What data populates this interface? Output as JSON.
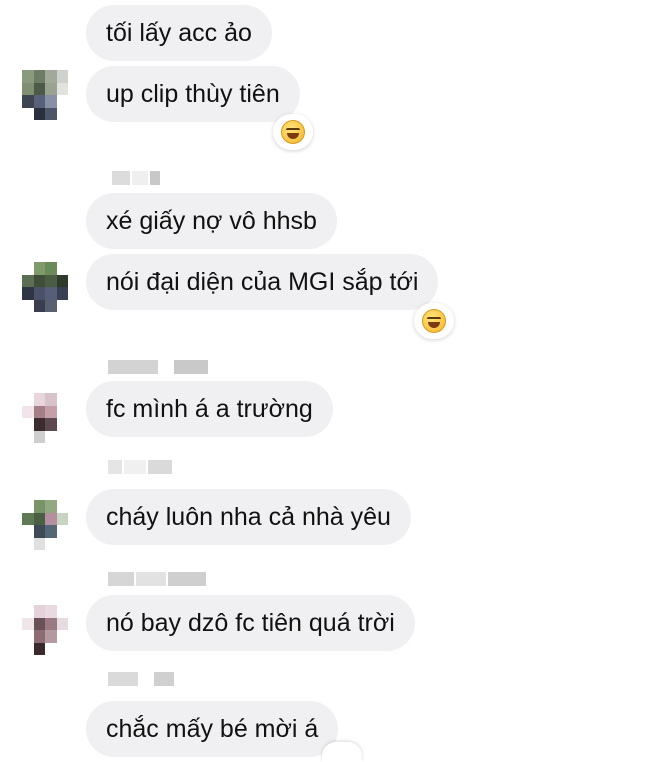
{
  "messages": [
    {
      "text": "tối lấy acc ảo"
    },
    {
      "text": "up clip thùy tiên",
      "reaction": "laughing-face-emoji"
    },
    {
      "text": "xé giấy nợ vô hhsb"
    },
    {
      "text": "nói đại diện của MGI sắp tới",
      "reaction": "laughing-face-emoji"
    },
    {
      "text": "fc mình á a trường"
    },
    {
      "text": "cháy luôn nha cả nhà yêu"
    },
    {
      "text": "nó bay dzô fc tiên quá trời"
    },
    {
      "text": "chắc mấy bé mời á"
    }
  ],
  "colors": {
    "bubble": "#f0f0f2",
    "text": "#111111",
    "background": "#ffffff"
  }
}
